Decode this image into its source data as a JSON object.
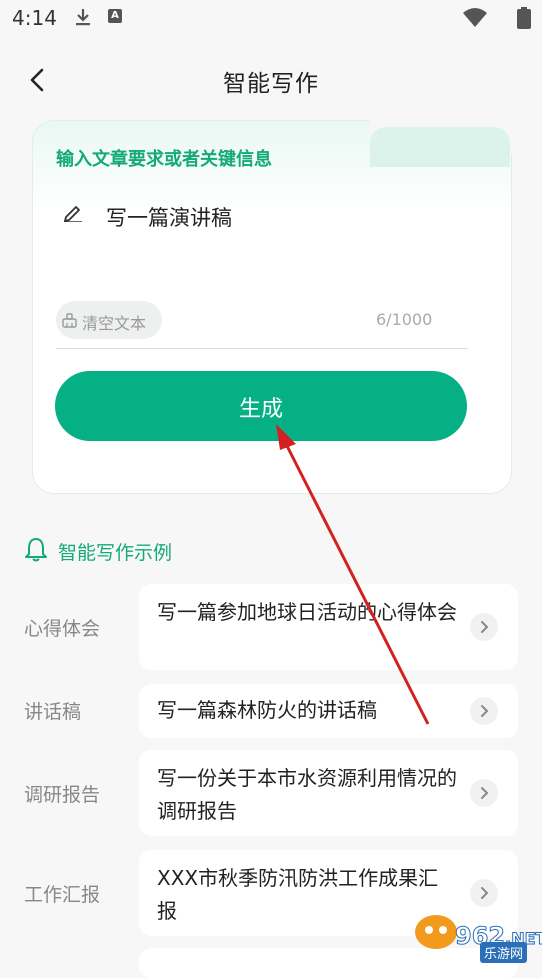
{
  "status_bar": {
    "time": "4:14",
    "badge": "A"
  },
  "header": {
    "title": "智能写作"
  },
  "composer": {
    "label": "输入文章要求或者关键信息",
    "input_value": "写一篇演讲稿",
    "clear_label": "清空文本",
    "counter": "6/1000",
    "generate_label": "生成"
  },
  "examples": {
    "title": "智能写作示例",
    "items": [
      {
        "category": "心得体会",
        "text": "写一篇参加地球日活动的心得体会"
      },
      {
        "category": "讲话稿",
        "text": "写一篇森林防火的讲话稿"
      },
      {
        "category": "调研报告",
        "text": "写一份关于本市水资源利用情况的调研报告"
      },
      {
        "category": "工作汇报",
        "text": "XXX市秋季防汛防洪工作成果汇报"
      }
    ]
  },
  "watermark": {
    "text": "962",
    "suffix": ".NET",
    "sub": "乐游网"
  },
  "colors": {
    "accent": "#05b084",
    "accent_text": "#14a978",
    "annotation_arrow": "#d32020"
  }
}
